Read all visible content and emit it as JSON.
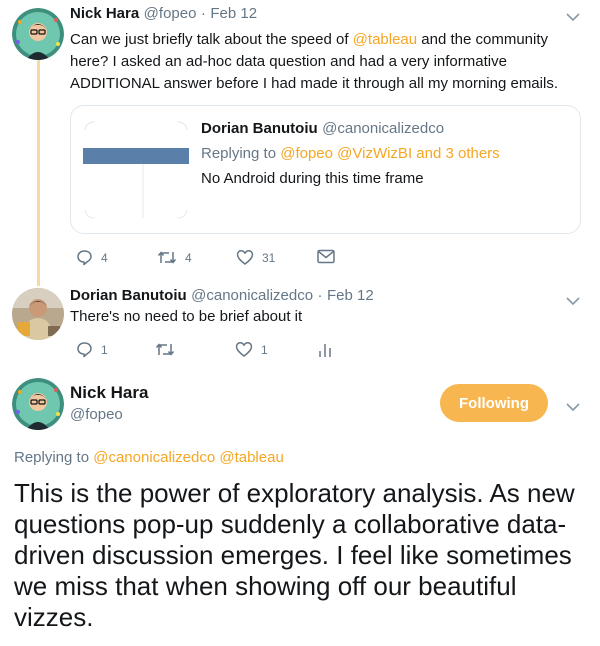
{
  "tweet1": {
    "name": "Nick Hara",
    "handle": "@fopeo",
    "separator": "·",
    "date": "Feb 12",
    "text_before_mention": "Can we just briefly talk about the speed of ",
    "mention": "@tableau",
    "text_after_mention": " and the community here? I asked an ad-hoc data question and had a very informative ADDITIONAL answer before I had made it through all my morning emails.",
    "quote": {
      "name": "Dorian Banutoiu",
      "handle": "@canonicalizedco",
      "replying_label": "Replying to",
      "replying_users": "@fopeo @VizWizBI",
      "replying_others": "and 3 others",
      "text": "No Android during this time frame"
    },
    "replies": "4",
    "retweets": "4",
    "likes": "31"
  },
  "tweet2": {
    "name": "Dorian Banutoiu",
    "handle": "@canonicalizedco",
    "separator": "·",
    "date": "Feb 12",
    "text": "There's no need to be brief about it",
    "replies": "1",
    "likes": "1"
  },
  "main": {
    "name": "Nick Hara",
    "handle": "@fopeo",
    "follow_label": "Following",
    "replying_label": "Replying to",
    "replying_mentions": "@canonicalizedco @tableau",
    "text": "This is the power of exploratory analysis. As new questions pop-up suddenly a collaborative data-driven discussion emerges. I feel like sometimes we miss that when showing off our beautiful vizzes."
  },
  "colors": {
    "accent": "#f5a623",
    "follow_button": "#f7b64f",
    "thread_line": "#f6d9a3",
    "text": "#14171a",
    "secondary": "#657786",
    "quote_bar": "#5a7fa8"
  },
  "icons": [
    "reply-icon",
    "retweet-icon",
    "like-icon",
    "message-icon",
    "analytics-icon",
    "chevron-down-icon",
    "avatar"
  ]
}
